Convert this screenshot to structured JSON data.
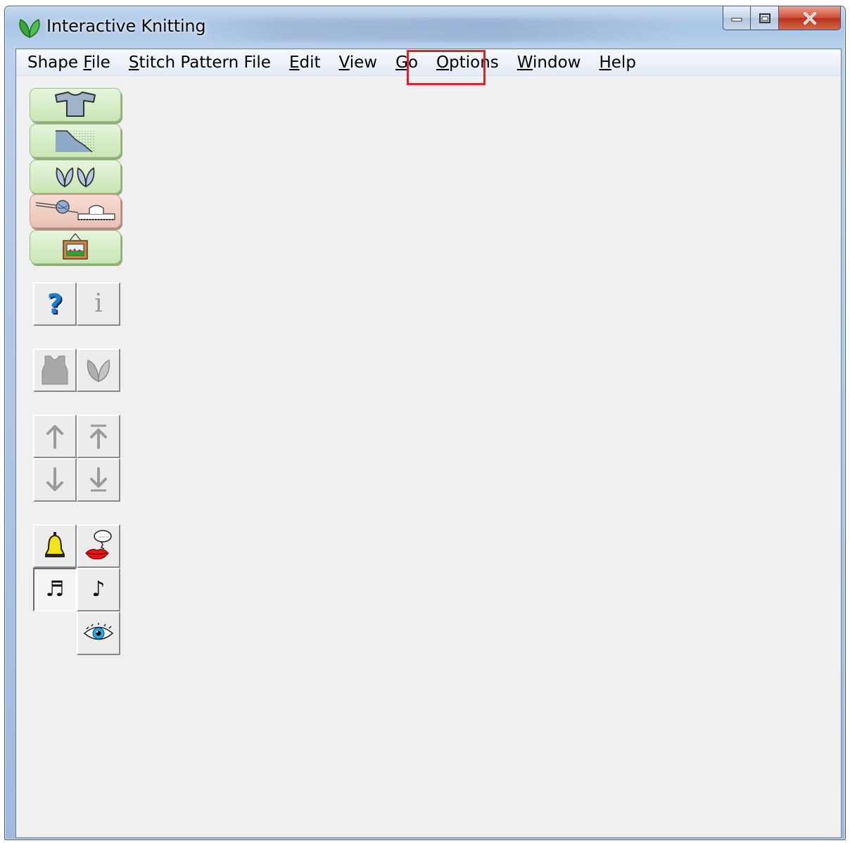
{
  "window": {
    "title": "Interactive Knitting"
  },
  "menu": [
    {
      "pre": "Shape ",
      "u": "F",
      "post": "ile"
    },
    {
      "pre": "",
      "u": "S",
      "post": "titch Pattern File"
    },
    {
      "pre": "",
      "u": "E",
      "post": "dit"
    },
    {
      "pre": "",
      "u": "V",
      "post": "iew"
    },
    {
      "pre": "",
      "u": "G",
      "post": "o"
    },
    {
      "pre": "",
      "u": "O",
      "post": "ptions"
    },
    {
      "pre": "",
      "u": "W",
      "post": "indow"
    },
    {
      "pre": "",
      "u": "H",
      "post": "elp"
    }
  ],
  "highlighted_menu": "Options",
  "icons": {
    "app": "knitting-leaf-icon",
    "toolbar_big": [
      "sweater-shape-icon",
      "stitch-chart-icon",
      "leaf-pattern-icon",
      "knitting-machine-icon",
      "framed-picture-icon"
    ],
    "help": "question-mark-icon",
    "info": "info-icon",
    "garment": "garment-icon",
    "leaf": "leaf-icon",
    "nav": [
      "arrow-up-icon",
      "arrow-to-top-icon",
      "arrow-down-icon",
      "arrow-to-bottom-icon"
    ],
    "sound": [
      "bell-icon",
      "speaking-lips-icon",
      "beamed-notes-icon",
      "single-note-icon",
      "eye-icon"
    ]
  },
  "colors": {
    "accent_highlight": "#e2202a",
    "help_blue": "#1a7fd0"
  }
}
